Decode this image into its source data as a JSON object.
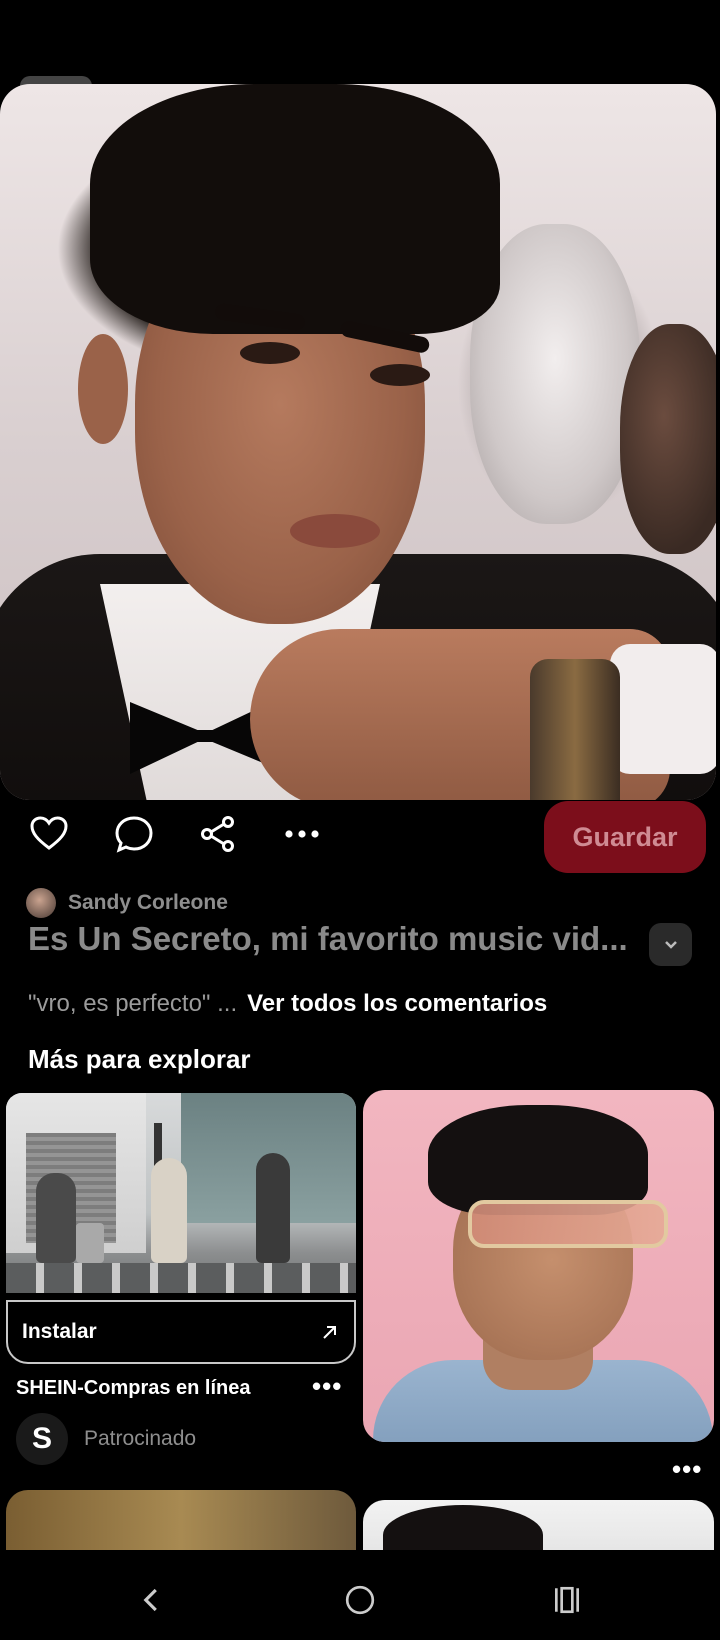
{
  "pin": {
    "author_name": "Sandy Corleone",
    "title": "Es Un Secreto, mi favorito music vid...",
    "comment_preview": "\"vro, es perfecto\" ...",
    "see_all_comments": "Ver todos los comentarios",
    "save_label": "Guardar"
  },
  "actions": {
    "like_icon": "heart-icon",
    "comment_icon": "comment-icon",
    "share_icon": "share-icon",
    "more_icon": "more-icon"
  },
  "explore": {
    "heading": "Más para explorar"
  },
  "ad": {
    "install_label": "Instalar",
    "title": "SHEIN-Compras en línea",
    "brand_initial": "S",
    "sponsored_label": "Patrocinado"
  },
  "colors": {
    "background": "#000000",
    "save_button": "#7c0e1b",
    "save_text": "#cf8b93",
    "muted_text": "#8e8e8e"
  }
}
